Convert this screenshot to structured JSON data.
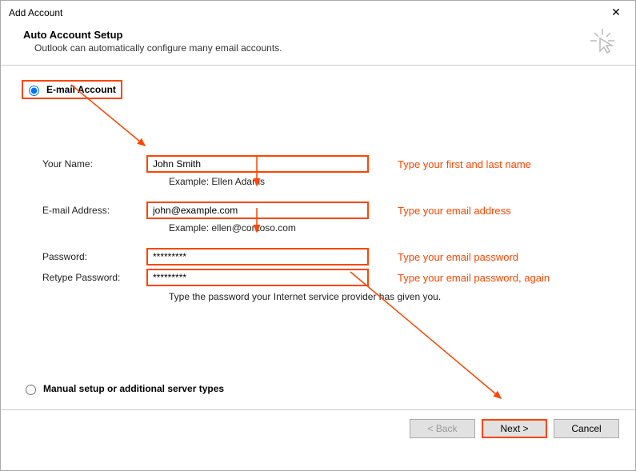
{
  "window": {
    "title": "Add Account"
  },
  "header": {
    "title": "Auto Account Setup",
    "subtitle": "Outlook can automatically configure many email accounts."
  },
  "radios": {
    "email_account": "E-mail Account",
    "manual": "Manual setup or additional server types"
  },
  "form": {
    "name_label": "Your Name:",
    "name_value": "John Smith",
    "name_example": "Example: Ellen Adams",
    "name_hint": "Type your first and last name",
    "email_label": "E-mail Address:",
    "email_value": "john@example.com",
    "email_example": "Example: ellen@contoso.com",
    "email_hint": "Type your email address",
    "pw_label": "Password:",
    "pw_value": "*********",
    "pw_hint": "Type your email password",
    "pw2_label": "Retype Password:",
    "pw2_value": "*********",
    "pw2_hint": "Type your email password, again",
    "pw_note": "Type the password your Internet service provider has given you."
  },
  "buttons": {
    "back": "< Back",
    "next": "Next >",
    "cancel": "Cancel"
  }
}
